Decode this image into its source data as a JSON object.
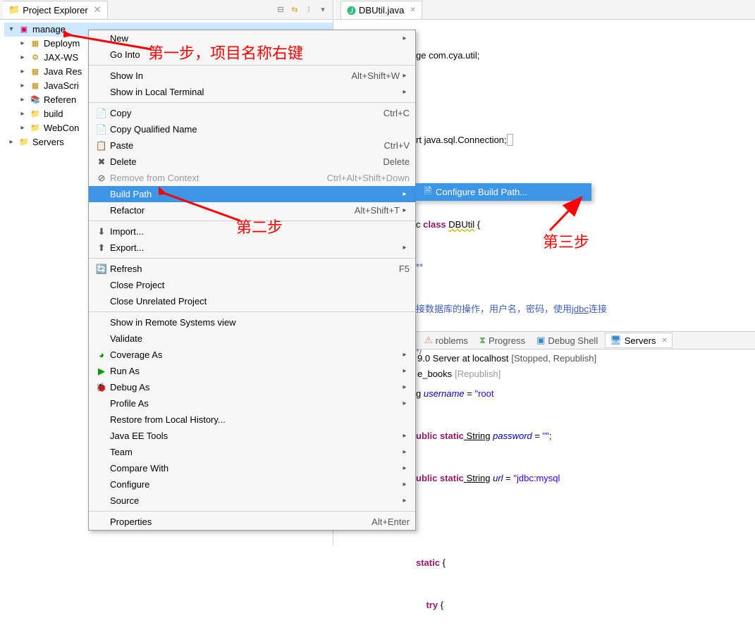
{
  "explorer": {
    "title": "Project Explorer",
    "project": "manage_",
    "children": [
      "Deploym",
      "JAX-WS",
      "Java Res",
      "JavaScri",
      "Referen",
      "build",
      "WebCon"
    ],
    "servers": "Servers"
  },
  "menu": {
    "new": "New",
    "goInto": "Go Into",
    "showIn": "Show In",
    "showInKey": "Alt+Shift+W",
    "showLocal": "Show in Local Terminal",
    "copy": "Copy",
    "copyKey": "Ctrl+C",
    "copyQ": "Copy Qualified Name",
    "paste": "Paste",
    "pasteKey": "Ctrl+V",
    "delete": "Delete",
    "deleteKey": "Delete",
    "removeCtx": "Remove from Context",
    "removeCtxKey": "Ctrl+Alt+Shift+Down",
    "buildPath": "Build Path",
    "refactor": "Refactor",
    "refactorKey": "Alt+Shift+T",
    "import": "Import...",
    "export": "Export...",
    "refresh": "Refresh",
    "refreshKey": "F5",
    "closeProj": "Close Project",
    "closeUnrel": "Close Unrelated Project",
    "showRemote": "Show in Remote Systems view",
    "validate": "Validate",
    "coverage": "Coverage As",
    "run": "Run As",
    "debug": "Debug As",
    "profile": "Profile As",
    "restore": "Restore from Local History...",
    "jee": "Java EE Tools",
    "team": "Team",
    "compare": "Compare With",
    "configure": "Configure",
    "source": "Source",
    "properties": "Properties",
    "propertiesKey": "Alt+Enter"
  },
  "submenu": {
    "configureBuild": "Configure Build Path..."
  },
  "editor": {
    "tab": "DBUtil.java",
    "line1a": "ge ",
    "line1b": "com.cya.util;",
    "line2a": "rt",
    "line2b": " java.sql.Connection;",
    "line3a": "c ",
    "line3kw": "class",
    "line3sp": " ",
    "line3cls": "DBUtil",
    "line3end": " {",
    "line4": "**",
    "line5": "接数据库的操作，用户名，密码，使用",
    "line5b": "jdbc",
    "line5c": "连接",
    "line6": "*/",
    "line7a": "g",
    "line7b": " username",
    "line7c": " = ",
    "line7d": "\"root",
    "line8a": "ublic",
    "line8b": " static",
    "line8c": " String",
    "line8d": " password",
    "line8e": " = ",
    "line8f": "\"\"",
    "line8g": ";",
    "line9a": "ublic",
    "line9b": " static",
    "line9c": " String",
    "line9d": " url",
    "line9e": " = ",
    "line9f": "\"jdbc:mysql",
    "line10": "static",
    "line10b": " {",
    "line11": "try",
    "line11b": " {"
  },
  "bottom": {
    "problems": "roblems",
    "progress": "Progress",
    "debugShell": "Debug Shell",
    "servers": "Servers",
    "srv1a": "9.0 Server at localhost  ",
    "srv1b": "[Stopped, Republish]",
    "srv2a": "e_books  ",
    "srv2b": "[Republish]"
  },
  "ann": {
    "step1": "第一步，项目名称右键",
    "step2": "第二步",
    "step3": "第三步"
  }
}
